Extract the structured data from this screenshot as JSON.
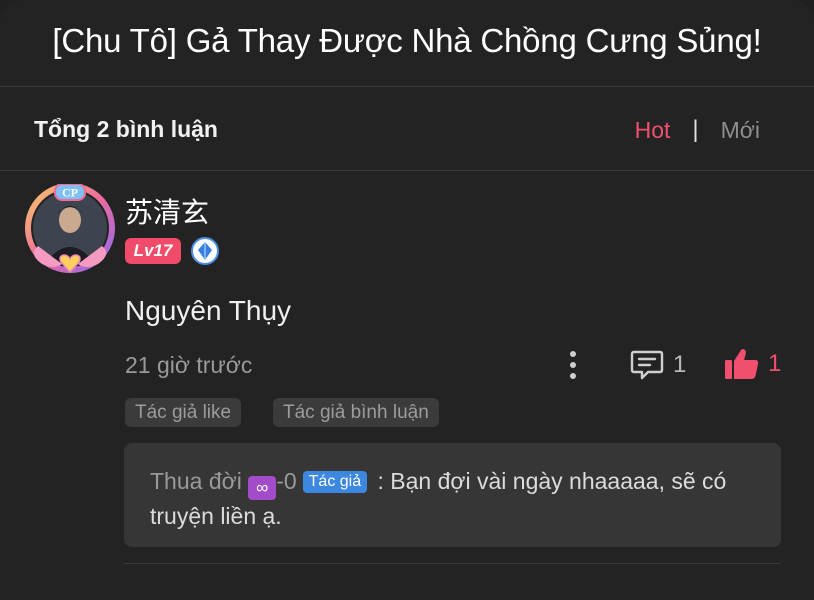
{
  "header": {
    "title": "[Chu Tô] Gả Thay Được Nhà Chồng Cưng Sủng!"
  },
  "comments_bar": {
    "total": "Tổng 2 bình luận",
    "sort_hot": "Hot",
    "sort_separator": "|",
    "sort_new": "Mới"
  },
  "comment": {
    "username": "苏清玄",
    "level": "Lv17",
    "avatar_badge": "CP",
    "content": "Nguyên Thụy",
    "time": "21 giờ trước",
    "reply_count": "1",
    "like_count": "1",
    "tags": [
      "Tác giả like",
      "Tác giả bình luận"
    ],
    "reply": {
      "name": "Thua đời",
      "name_suffix": "-0",
      "emoji": "∞",
      "author_badge": "Tác giả",
      "separator": ":",
      "text": "Bạn đợi vài ngày nhaaaaa, sẽ có truyện liền ạ."
    }
  },
  "colors": {
    "accent": "#f0506e",
    "background": "#232323",
    "reply_bg": "#363636",
    "author_badge": "#3c87e0"
  }
}
